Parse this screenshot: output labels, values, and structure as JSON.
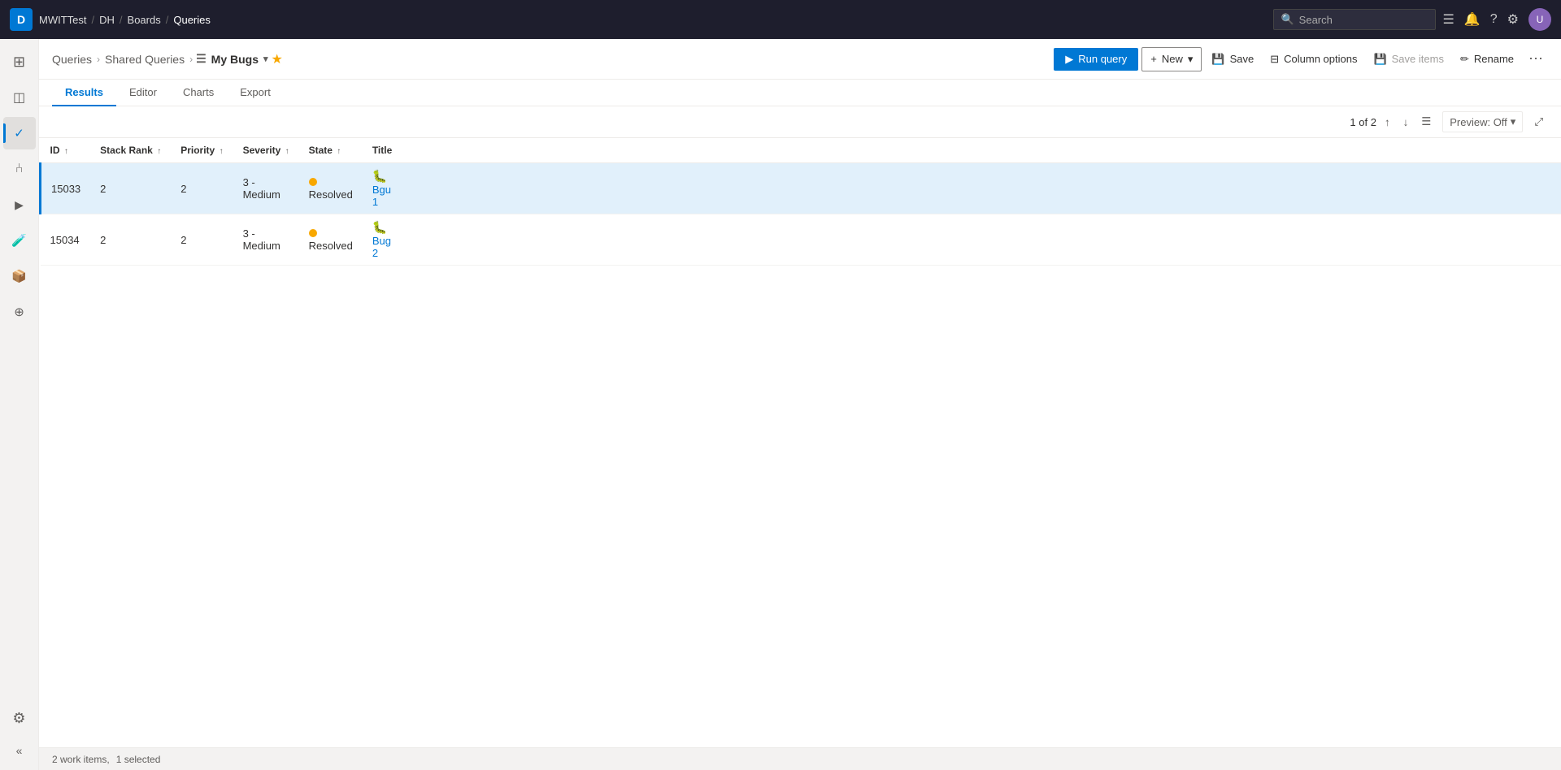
{
  "app": {
    "logo": "D",
    "nav": {
      "items": [
        {
          "label": "MWITTest",
          "sep": "/"
        },
        {
          "label": "DH",
          "sep": "/"
        },
        {
          "label": "Boards",
          "sep": "/"
        },
        {
          "label": "Queries",
          "sep": ""
        }
      ]
    },
    "search_placeholder": "Search"
  },
  "sidebar": {
    "items": [
      {
        "id": "home",
        "icon": "⊞",
        "active": false
      },
      {
        "id": "boards",
        "icon": "📋",
        "active": false
      },
      {
        "id": "work-items",
        "icon": "✓",
        "active": true
      },
      {
        "id": "repos",
        "icon": "⑃",
        "active": false
      },
      {
        "id": "pipelines",
        "icon": "▶",
        "active": false
      },
      {
        "id": "test-plans",
        "icon": "🧪",
        "active": false
      },
      {
        "id": "artifacts",
        "icon": "📦",
        "active": false
      },
      {
        "id": "extensions",
        "icon": "🔌",
        "active": false
      }
    ],
    "bottom": [
      {
        "id": "settings",
        "icon": "⚙"
      },
      {
        "id": "collapse",
        "icon": "«"
      }
    ]
  },
  "header": {
    "breadcrumbs": [
      {
        "label": "Queries",
        "sep": "›"
      },
      {
        "label": "Shared Queries",
        "sep": "›"
      }
    ],
    "query_name": "My Bugs",
    "starred": true,
    "buttons": {
      "run_query": "Run query",
      "new": "New",
      "save": "Save",
      "column_options": "Column options",
      "save_items": "Save items",
      "rename": "Rename"
    }
  },
  "tabs": [
    {
      "label": "Results",
      "active": true
    },
    {
      "label": "Editor",
      "active": false
    },
    {
      "label": "Charts",
      "active": false
    },
    {
      "label": "Export",
      "active": false
    }
  ],
  "toolbar": {
    "pagination": "1 of 2",
    "preview_label": "Preview: Off"
  },
  "table": {
    "columns": [
      {
        "label": "ID",
        "sort": "↑"
      },
      {
        "label": "Stack Rank",
        "sort": "↑"
      },
      {
        "label": "Priority",
        "sort": "↑"
      },
      {
        "label": "Severity",
        "sort": "↑"
      },
      {
        "label": "State",
        "sort": "↑"
      },
      {
        "label": "Title",
        "sort": ""
      }
    ],
    "rows": [
      {
        "id": "15033",
        "stack_rank": "2",
        "priority": "2",
        "severity": "3 - Medium",
        "state": "Resolved",
        "state_color": "#f8a800",
        "title": "Bgu 1",
        "selected": true
      },
      {
        "id": "15034",
        "stack_rank": "2",
        "priority": "2",
        "severity": "3 - Medium",
        "state": "Resolved",
        "state_color": "#f8a800",
        "title": "Bug 2",
        "selected": false
      }
    ]
  },
  "status_bar": {
    "work_items_count": "2 work items,",
    "selected_count": "1 selected"
  }
}
